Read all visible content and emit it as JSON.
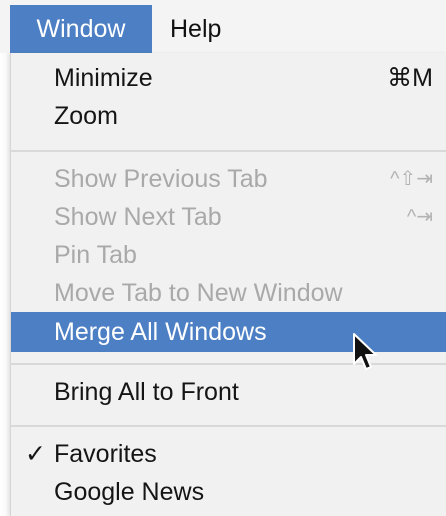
{
  "menubar": {
    "items": [
      {
        "label": "Window"
      },
      {
        "label": "Help"
      }
    ]
  },
  "menu": {
    "minimize": {
      "label": "Minimize",
      "shortcut": "⌘M"
    },
    "zoom": {
      "label": "Zoom"
    },
    "show_previous_tab": {
      "label": "Show Previous Tab",
      "shortcut": "^⇧⇥"
    },
    "show_next_tab": {
      "label": "Show Next Tab",
      "shortcut": "^⇥"
    },
    "pin_tab": {
      "label": "Pin Tab"
    },
    "move_tab": {
      "label": "Move Tab to New Window"
    },
    "merge_all": {
      "label": "Merge All Windows"
    },
    "bring_all_front": {
      "label": "Bring All to Front"
    },
    "favorites": {
      "label": "Favorites",
      "check": "✓"
    },
    "google_news": {
      "label": "Google News"
    }
  },
  "colors": {
    "highlight": "#4c7fc4",
    "disabled_text": "#a9a9a9",
    "menu_background": "#f1f1f1"
  },
  "icons": {
    "cursor": "arrow-pointer-icon",
    "checkmark": "checkmark-icon"
  }
}
